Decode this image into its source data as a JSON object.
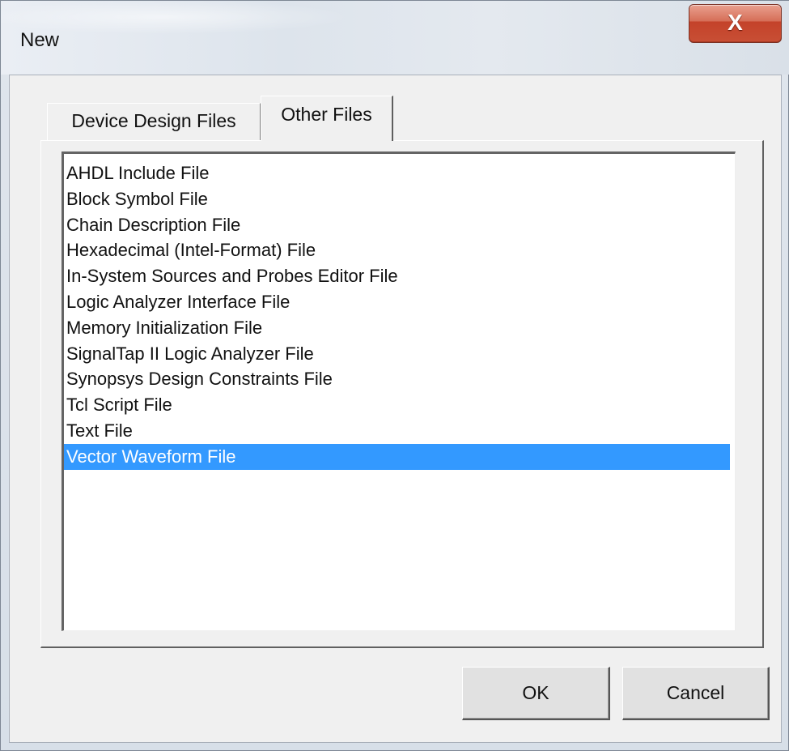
{
  "window": {
    "title": "New",
    "close_label": "X"
  },
  "tabs": [
    {
      "label": "Device Design Files"
    },
    {
      "label": "Other Files",
      "selected": true
    }
  ],
  "file_types": [
    {
      "label": "AHDL Include File"
    },
    {
      "label": "Block Symbol File"
    },
    {
      "label": "Chain Description File"
    },
    {
      "label": "Hexadecimal (Intel-Format) File"
    },
    {
      "label": "In-System Sources and Probes Editor File"
    },
    {
      "label": "Logic Analyzer Interface File"
    },
    {
      "label": "Memory Initialization File"
    },
    {
      "label": "SignalTap II Logic Analyzer File"
    },
    {
      "label": "Synopsys Design Constraints File"
    },
    {
      "label": "Tcl Script File"
    },
    {
      "label": "Text File"
    },
    {
      "label": "Vector Waveform File",
      "selected": true
    }
  ],
  "buttons": {
    "ok": "OK",
    "cancel": "Cancel"
  },
  "colors": {
    "selection": "#3399ff",
    "close_button": "#c8442c"
  }
}
